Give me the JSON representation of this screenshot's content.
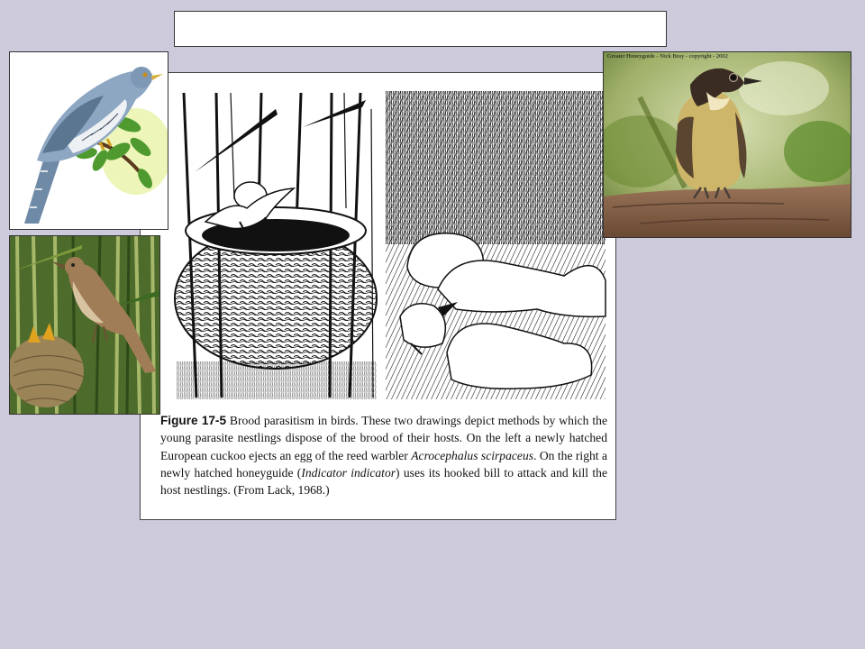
{
  "slide": {
    "title_box_text": ""
  },
  "figure": {
    "caption_number": "Figure 17-5",
    "caption_parts": [
      " Brood parasitism in birds. These two drawings depict methods by which the young parasite nestlings dispose of the brood of their hosts. On the left a newly hatched European cuckoo ejects an egg of the reed warbler ",
      "Acrocephalus scirpaceus",
      ". On the right a newly hatched honeyguide (",
      "Indicator indicator",
      ") uses its hooked bill to attack and kill the host nestlings. (From Lack, 1968.)"
    ]
  },
  "photos": {
    "cuckoo": {
      "subject": "common-cuckoo-illustration"
    },
    "warbler": {
      "subject": "reed-warbler-at-nest"
    },
    "honeyguide": {
      "subject": "greater-honeyguide",
      "credit": "Greater Honeyguide  -  Nick Bray  -  copyright - 2002"
    }
  },
  "colors": {
    "background": "#cccadb",
    "ink": "#111111"
  }
}
